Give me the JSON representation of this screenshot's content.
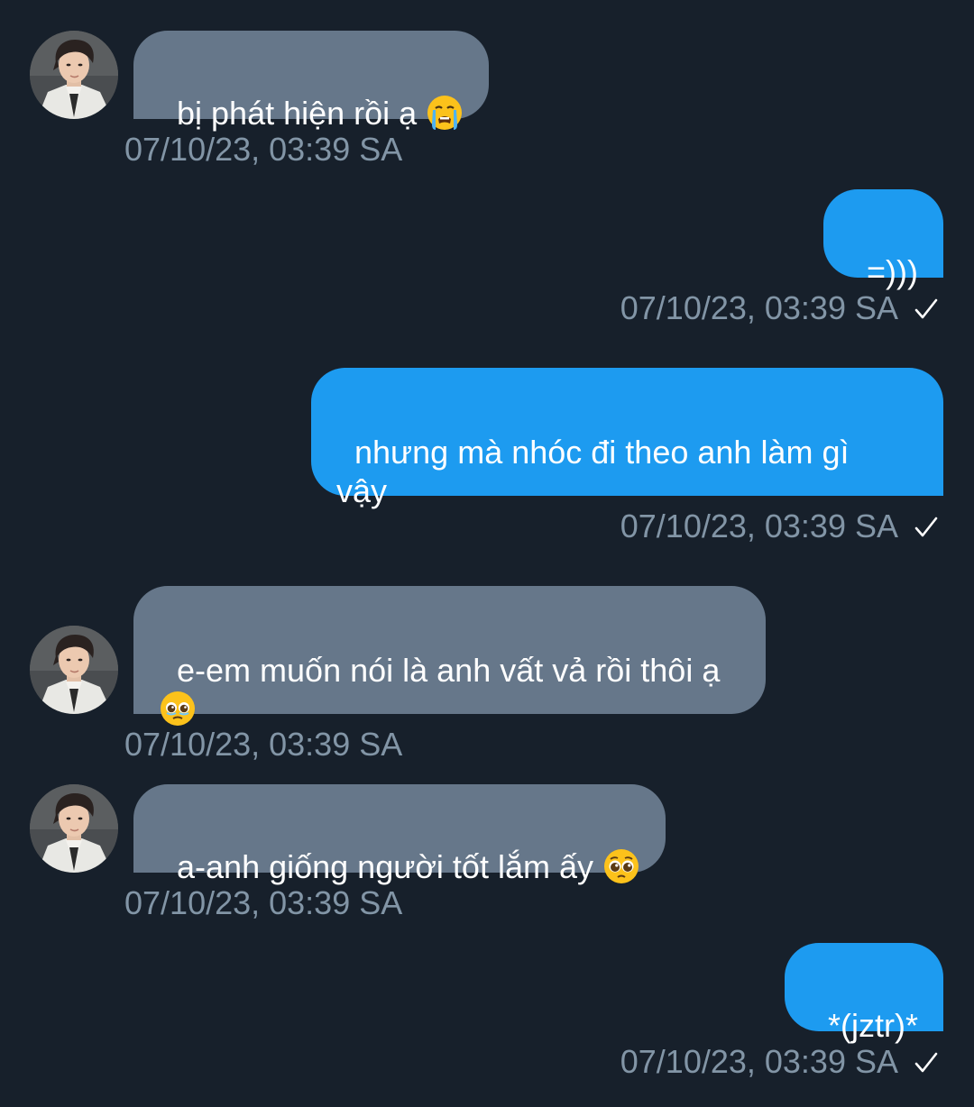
{
  "colors": {
    "background": "#17202b",
    "incoming_bubble": "#66778a",
    "outgoing_bubble": "#1d9bf0",
    "timestamp": "#8295a6"
  },
  "messages": [
    {
      "direction": "incoming",
      "text": "bị phát hiện rồi ạ ",
      "emoji": "loudly-crying-face",
      "timestamp": "07/10/23, 03:39 SA"
    },
    {
      "direction": "outgoing",
      "text": "=)))",
      "timestamp": "07/10/23, 03:39 SA",
      "status_icon": "check-icon"
    },
    {
      "direction": "outgoing",
      "text": "nhưng mà nhóc đi theo anh làm gì\nvậy",
      "timestamp": "07/10/23, 03:39 SA",
      "status_icon": "check-icon"
    },
    {
      "direction": "incoming",
      "text": "e-em muốn nói là anh vất vả rồi thôi ạ\n",
      "emoji": "face-holding-back-tears",
      "timestamp": "07/10/23, 03:39 SA"
    },
    {
      "direction": "incoming",
      "text": "a-anh giống người tốt lắm ấy ",
      "emoji": "pleading-face",
      "timestamp": "07/10/23, 03:39 SA"
    },
    {
      "direction": "outgoing",
      "text": "*(jztr)*",
      "timestamp": "07/10/23, 03:39 SA",
      "status_icon": "check-icon"
    }
  ]
}
